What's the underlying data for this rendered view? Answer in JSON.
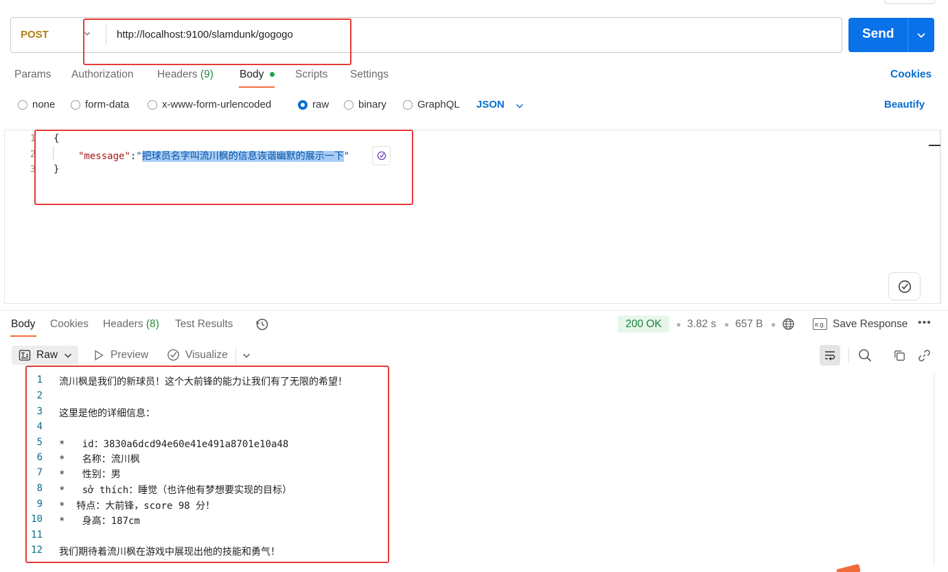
{
  "request": {
    "method": "POST",
    "url": "http://localhost:9100/slamdunk/gogogo",
    "send_label": "Send"
  },
  "request_tabs": {
    "params": "Params",
    "authorization": "Authorization",
    "headers": "Headers",
    "headers_count": "(9)",
    "body": "Body",
    "scripts": "Scripts",
    "settings": "Settings",
    "cookies": "Cookies"
  },
  "body_types": {
    "none": "none",
    "form_data": "form-data",
    "urlencoded": "x-www-form-urlencoded",
    "raw": "raw",
    "binary": "binary",
    "graphql": "GraphQL",
    "selected": "raw",
    "format": "JSON",
    "beautify": "Beautify"
  },
  "editor": {
    "line_numbers": [
      "1",
      "2",
      "3"
    ],
    "open_brace": "{",
    "key": "\"message\"",
    "colon": ":",
    "quote_open": "\"",
    "value": "把球员名字叫流川枫的信息诙谐幽默的展示一下",
    "quote_close": "\"",
    "close_brace": "}"
  },
  "response_tabs": {
    "body": "Body",
    "cookies": "Cookies",
    "headers": "Headers",
    "headers_count": "(8)",
    "test_results": "Test Results"
  },
  "response_meta": {
    "status": "200 OK",
    "time": "3.82 s",
    "size": "657 B",
    "eg_badge": "e.g.",
    "save_response": "Save Response",
    "more": "•••"
  },
  "response_toolbar": {
    "raw": "Raw",
    "preview": "Preview",
    "visualize": "Visualize"
  },
  "response_body": {
    "lines": [
      {
        "n": "1",
        "text": "流川枫是我们的新球员！这个大前锋的能力让我们有了无限的希望！"
      },
      {
        "n": "2",
        "text": ""
      },
      {
        "n": "3",
        "text": "这里是他的详细信息："
      },
      {
        "n": "4",
        "text": ""
      },
      {
        "n": "5",
        "text": "*   id：3830a6dcd94e60e41e491a8701e10a48"
      },
      {
        "n": "6",
        "text": "*   名称：流川枫"
      },
      {
        "n": "7",
        "text": "*   性别：男"
      },
      {
        "n": "8",
        "text": "*   sở thích：睡觉（也许他有梦想要实现的目标）"
      },
      {
        "n": "9",
        "text": "*  特点：大前锋，score 98 分！"
      },
      {
        "n": "10",
        "text": "*   身高：187cm"
      },
      {
        "n": "11",
        "text": ""
      },
      {
        "n": "12",
        "text": "我们期待着流川枫在游戏中展现出他的技能和勇气！"
      }
    ]
  },
  "colors": {
    "accent": "#0a72e8",
    "method": "#b07d12",
    "status_ok": "#18803a",
    "highlight_box": "#e53935",
    "tab_underline": "#f26b3a"
  }
}
